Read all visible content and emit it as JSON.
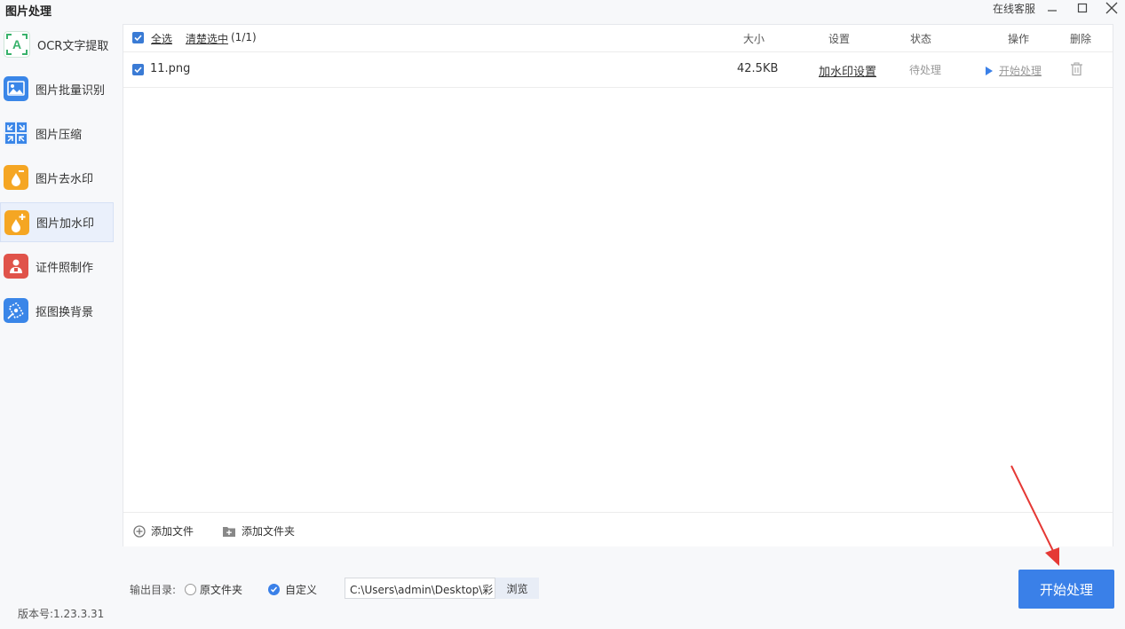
{
  "window": {
    "title": "图片处理",
    "support_label": "在线客服",
    "buttons": [
      "minimize",
      "maximize",
      "close"
    ]
  },
  "sidebar": {
    "items": [
      {
        "label": "OCR文字提取",
        "icon": "ocr-icon",
        "color": "#ffffff",
        "active": false
      },
      {
        "label": "图片批量识别",
        "icon": "image-recognition-icon",
        "color": "#3a86e8",
        "active": false
      },
      {
        "label": "图片压缩",
        "icon": "compress-icon",
        "color": "#3a86e8",
        "active": false
      },
      {
        "label": "图片去水印",
        "icon": "remove-watermark-icon",
        "color": "#f5a623",
        "active": false
      },
      {
        "label": "图片加水印",
        "icon": "add-watermark-icon",
        "color": "#f5a623",
        "active": true
      },
      {
        "label": "证件照制作",
        "icon": "id-photo-icon",
        "color": "#e0534a",
        "active": false
      },
      {
        "label": "抠图换背景",
        "icon": "cutout-background-icon",
        "color": "#3a86e8",
        "active": false
      }
    ]
  },
  "table": {
    "select_all": "全选",
    "clear_selection": "清楚选中",
    "selection_count": "(1/1)",
    "headers": {
      "size": "大小",
      "settings": "设置",
      "status": "状态",
      "action": "操作",
      "delete": "删除"
    },
    "rows": [
      {
        "checked": true,
        "filename": "11.png",
        "size": "42.5KB",
        "settings_link": "加水印设置",
        "status": "待处理",
        "action": "开始处理"
      }
    ]
  },
  "bottom": {
    "add_file": "添加文件",
    "add_folder": "添加文件夹"
  },
  "output": {
    "label": "输出目录:",
    "option_original": "原文件夹",
    "option_custom": "自定义",
    "selected": "custom",
    "path": "C:\\Users\\admin\\Desktop\\彩",
    "browse": "浏览"
  },
  "start_button": "开始处理",
  "version": "版本号:1.23.3.31",
  "colors": {
    "accent": "#3a80e8",
    "sidebar_active": "#eaf0fb",
    "arrow": "#e53935"
  }
}
